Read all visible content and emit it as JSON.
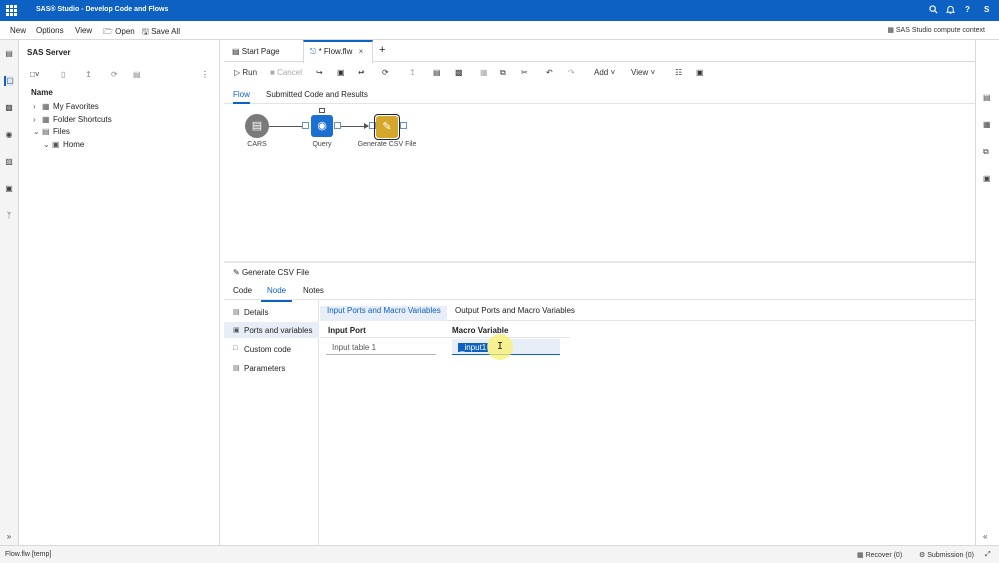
{
  "titlebar": {
    "title": "SAS® Studio - Develop Code and Flows",
    "icons": {
      "search": "search-icon",
      "bell": "bell-icon",
      "help": "?",
      "user": "S"
    }
  },
  "menu": {
    "new": "New",
    "options": "Options",
    "view": "View",
    "open": "Open",
    "save_all": "Save All",
    "context": "SAS Studio compute context"
  },
  "nav": {
    "title": "SAS Server",
    "column": "Name",
    "tree": [
      {
        "label": "My Favorites"
      },
      {
        "label": "Folder Shortcuts"
      },
      {
        "label": "Files"
      },
      {
        "label": "Home"
      }
    ]
  },
  "tabs": {
    "start": "Start Page",
    "flow": "* Flow.flw"
  },
  "toolbar": {
    "run": "Run",
    "cancel": "Cancel",
    "add": "Add",
    "view": "View"
  },
  "subtabs": {
    "flow": "Flow",
    "submitted": "Submitted Code and Results"
  },
  "flow": {
    "nodes": [
      {
        "label": "CARS"
      },
      {
        "label": "Query"
      },
      {
        "label": "Generate CSV File"
      }
    ]
  },
  "props": {
    "title": "Generate CSV File",
    "tabs": {
      "code": "Code",
      "node": "Node",
      "notes": "Notes"
    },
    "nav": {
      "details": "Details",
      "ports": "Ports and variables",
      "custom": "Custom code",
      "parameters": "Parameters"
    },
    "port_tabs": {
      "input": "Input Ports and Macro Variables",
      "output": "Output Ports and Macro Variables"
    },
    "input_port_header": "Input Port",
    "macro_header": "Macro Variable",
    "input_port_value": "Input table 1",
    "macro_value": "_input1"
  },
  "status": {
    "file": "Flow.flw [temp]",
    "recover": "Recover (0)",
    "submission": "Submission (0)"
  },
  "colors": {
    "accent": "#0d61c2",
    "query_node": "#1a6fd1",
    "csv_node": "#d4a72c"
  }
}
